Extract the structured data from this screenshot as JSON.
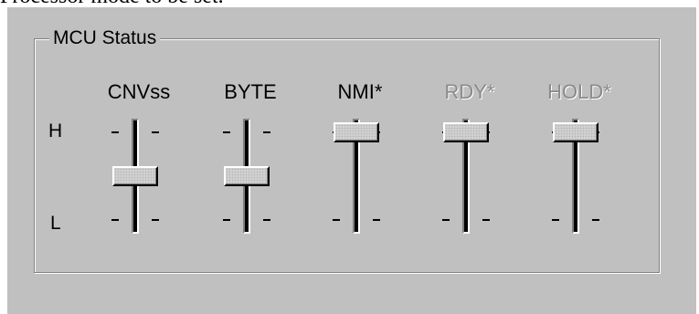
{
  "top_text": "Processor mode to be set.",
  "group": {
    "title": "MCU Status"
  },
  "level_labels": {
    "high": "H",
    "low": "L"
  },
  "controls": [
    {
      "label": "CNVss",
      "enabled": true,
      "position": 0.5
    },
    {
      "label": "BYTE",
      "enabled": true,
      "position": 0.5
    },
    {
      "label": "NMI*",
      "enabled": true,
      "position": 0.0
    },
    {
      "label": "RDY*",
      "enabled": false,
      "position": 0.0
    },
    {
      "label": "HOLD*",
      "enabled": false,
      "position": 0.0
    }
  ],
  "colors": {
    "panel": "#c0c0c0",
    "disabled_text": "#8a8a8a"
  }
}
